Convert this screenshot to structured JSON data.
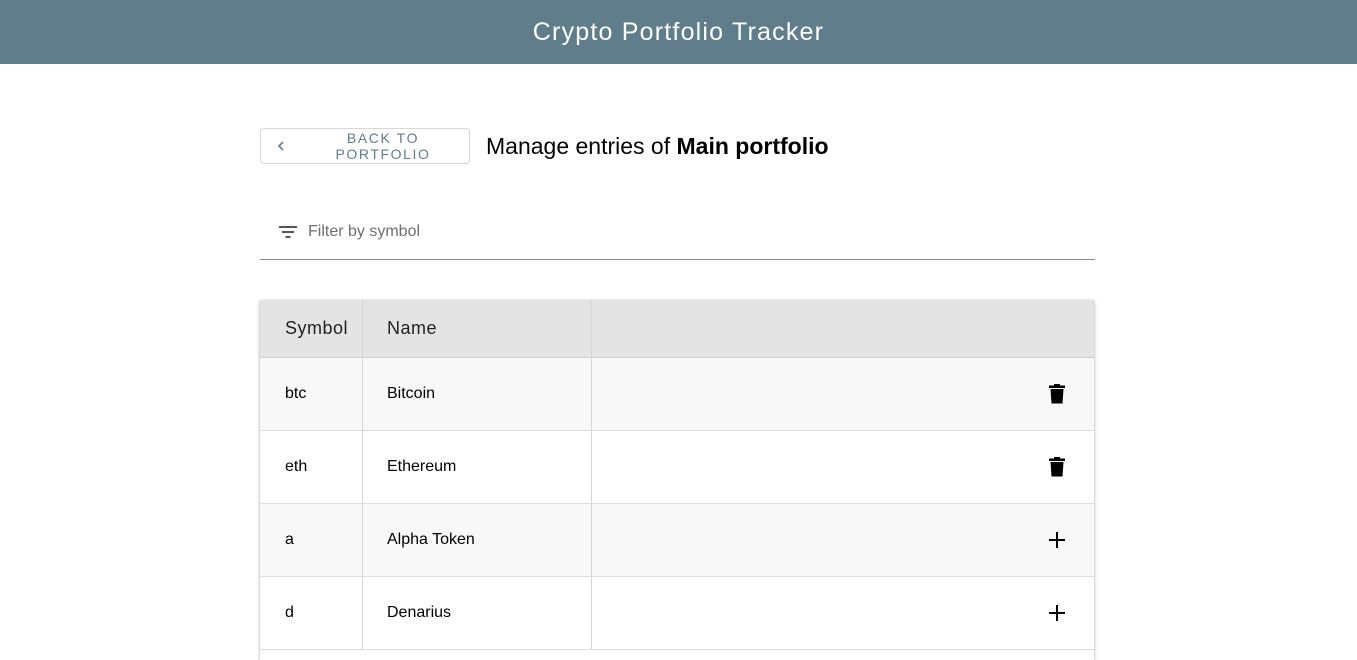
{
  "app": {
    "title": "Crypto Portfolio Tracker"
  },
  "toolbar": {
    "back_label": "BACK TO PORTFOLIO",
    "heading_prefix": "Manage entries of ",
    "portfolio_name": "Main portfolio"
  },
  "filter": {
    "placeholder": "Filter by symbol",
    "value": "",
    "icon": "filter-list-icon"
  },
  "table": {
    "headers": {
      "symbol": "Symbol",
      "name": "Name",
      "action": ""
    },
    "rows": [
      {
        "symbol": "btc",
        "name": "Bitcoin",
        "action": "delete",
        "icon": "trash-icon"
      },
      {
        "symbol": "eth",
        "name": "Ethereum",
        "action": "delete",
        "icon": "trash-icon"
      },
      {
        "symbol": "a",
        "name": "Alpha Token",
        "action": "add",
        "icon": "plus-icon"
      },
      {
        "symbol": "d",
        "name": "Denarius",
        "action": "add",
        "icon": "plus-icon"
      }
    ]
  },
  "colors": {
    "header_bar": "#607d8b",
    "accent_text": "#607d8b",
    "table_header_bg": "#e4e4e4",
    "row_alt_bg": "#f8f8f8"
  }
}
